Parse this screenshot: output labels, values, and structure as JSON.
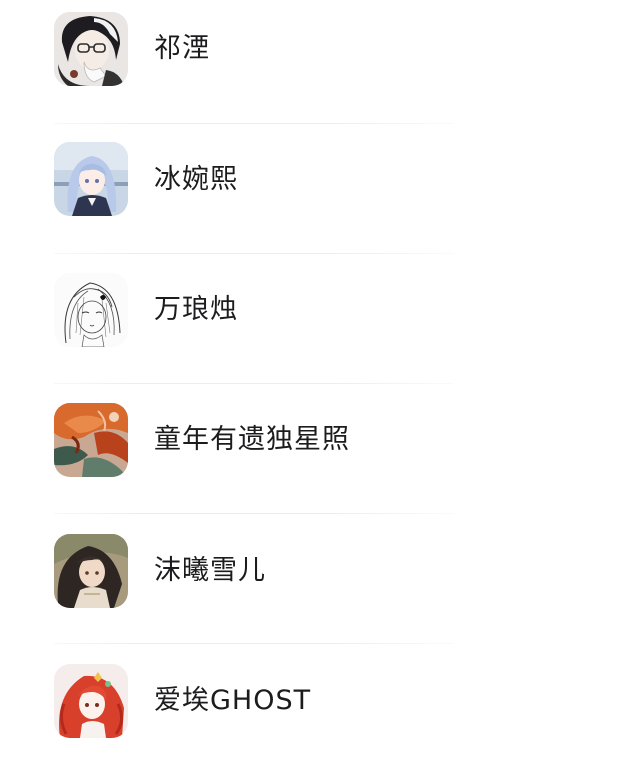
{
  "contacts": [
    {
      "name": "祁湮",
      "avatar": "avatar-glasses-dark-hair-icon"
    },
    {
      "name": "冰婉熙",
      "avatar": "avatar-blue-hair-girl-icon"
    },
    {
      "name": "万琅烛",
      "avatar": "avatar-line-sketch-icon"
    },
    {
      "name": "童年有遗独星照",
      "avatar": "avatar-orange-abstract-icon"
    },
    {
      "name": "沫曦雪儿",
      "avatar": "avatar-dark-hair-girl-icon"
    },
    {
      "name": "爱埃GHOST",
      "avatar": "avatar-red-hair-girl-icon"
    }
  ],
  "colors": {
    "text": "#1c1c1e",
    "divider": "#ededed",
    "background": "#ffffff"
  }
}
